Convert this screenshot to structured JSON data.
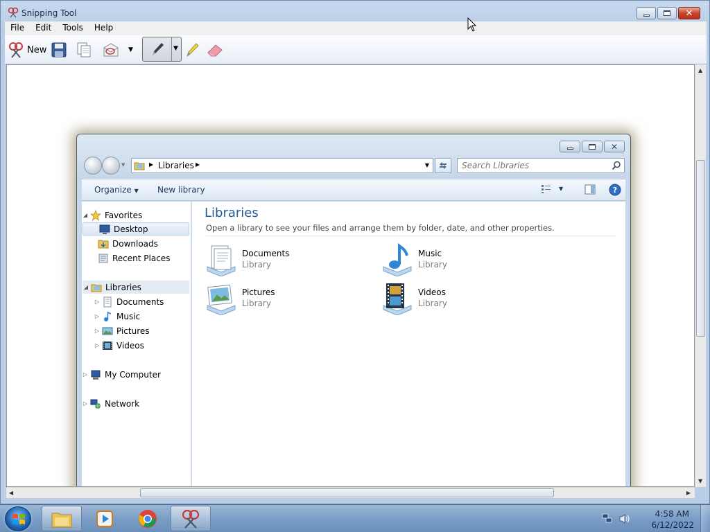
{
  "snipping_tool": {
    "title": "Snipping Tool",
    "menu": [
      "File",
      "Edit",
      "Tools",
      "Help"
    ],
    "toolbar": {
      "new_label": "New",
      "icons": [
        "new-snip-icon",
        "save-icon",
        "copy-icon",
        "send-snip-icon",
        "pen-icon",
        "highlighter-icon",
        "eraser-icon"
      ]
    }
  },
  "explorer": {
    "address": {
      "segments": [
        "Libraries"
      ]
    },
    "search": {
      "placeholder": "Search Libraries"
    },
    "commands": {
      "organize": "Organize",
      "new_library": "New library"
    },
    "nav": {
      "favorites": "Favorites",
      "desktop": "Desktop",
      "downloads": "Downloads",
      "recent_places": "Recent Places",
      "libraries": "Libraries",
      "documents": "Documents",
      "music": "Music",
      "pictures": "Pictures",
      "videos": "Videos",
      "my_computer": "My Computer",
      "network": "Network"
    },
    "content": {
      "title": "Libraries",
      "description": "Open a library to see your files and arrange them by folder, date, and other properties.",
      "items": [
        {
          "name": "Documents",
          "type": "Library"
        },
        {
          "name": "Music",
          "type": "Library"
        },
        {
          "name": "Pictures",
          "type": "Library"
        },
        {
          "name": "Videos",
          "type": "Library"
        }
      ]
    }
  },
  "taskbar": {
    "clock_time": "4:58 AM",
    "clock_date": "6/12/2022",
    "pinned": [
      "explorer",
      "media-player",
      "chrome",
      "snipping-tool"
    ]
  },
  "colors": {
    "accent_title": "#1e5a96",
    "taskbar": "#7b9ec6",
    "close_button": "#c8452f"
  }
}
